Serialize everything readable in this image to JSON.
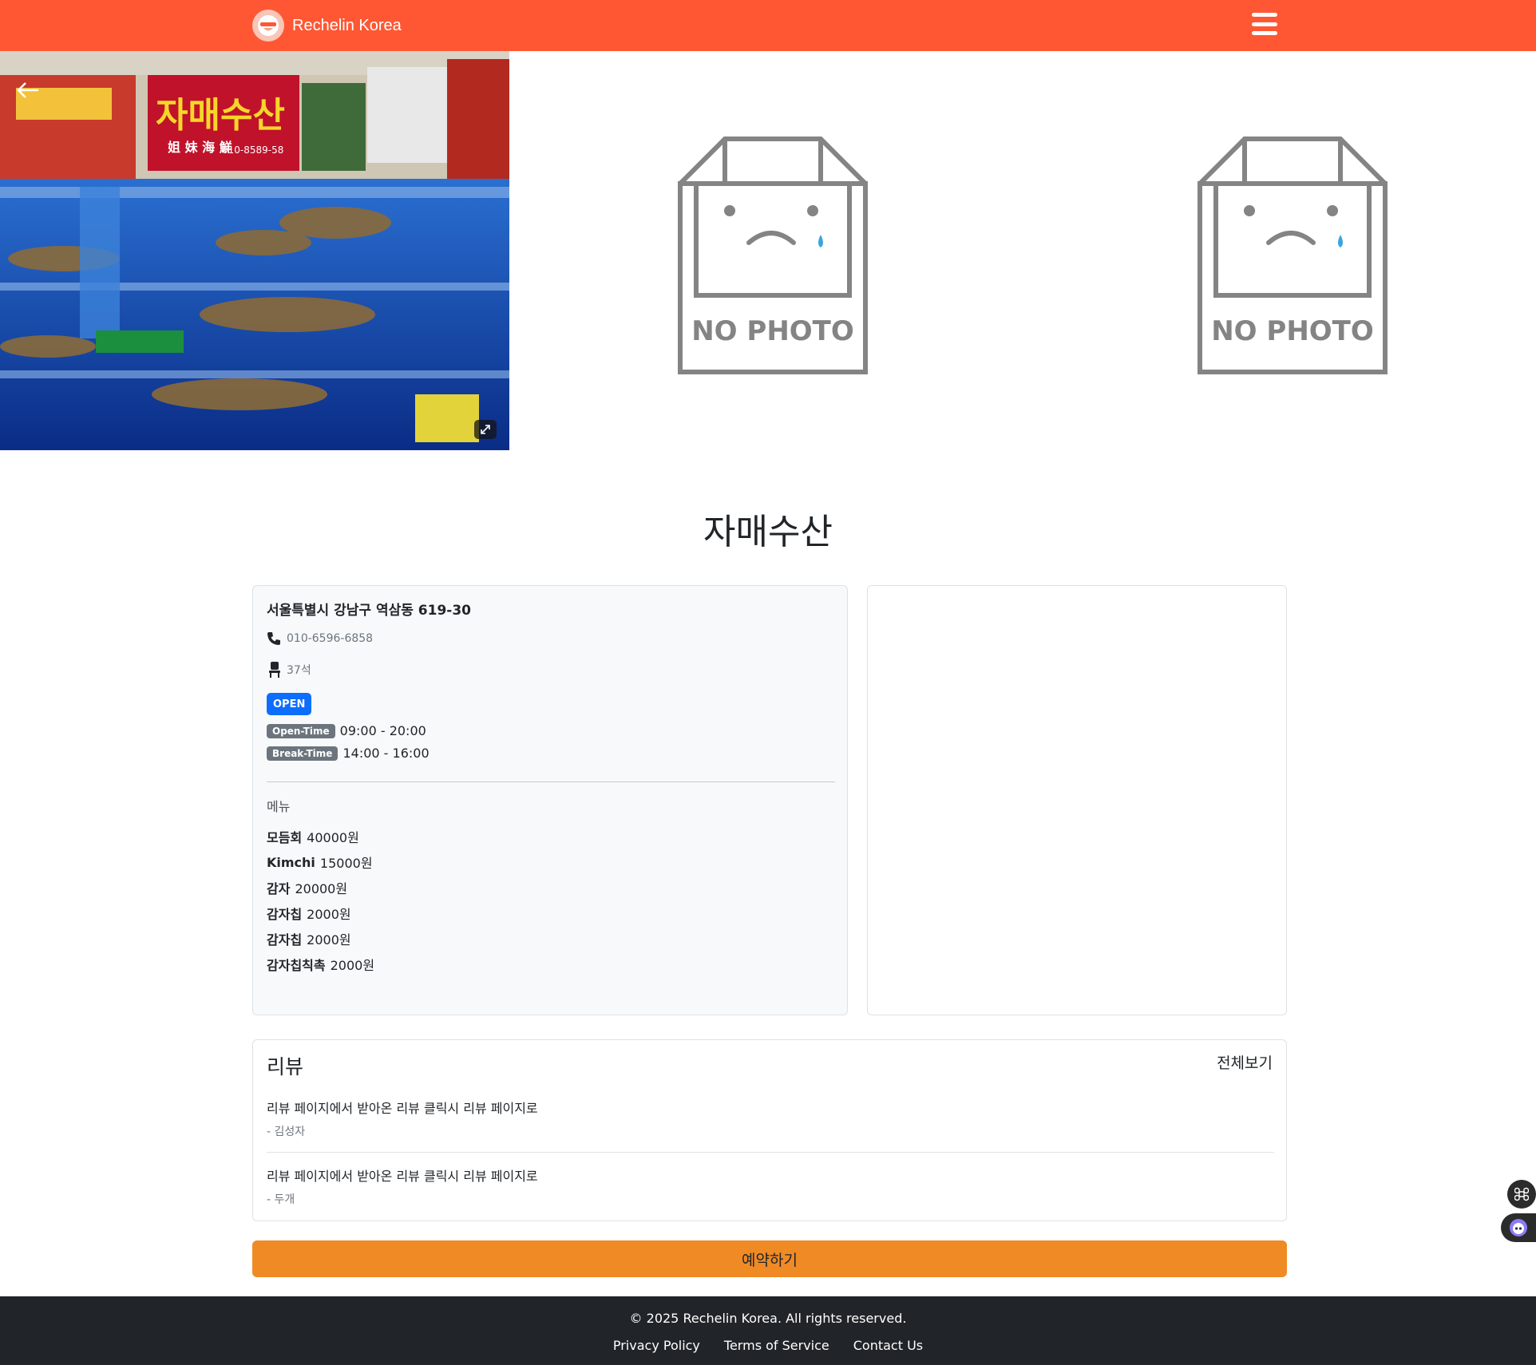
{
  "header": {
    "brand": "Rechelin Korea",
    "brand_color": "#ff5733"
  },
  "gallery": {
    "main_photo": {
      "sign_text": "자매수산",
      "sign_sub": "姐 妹 海 鮮",
      "sign_phone": "010-8589-58"
    },
    "placeholders": [
      {
        "label": "NO PHOTO"
      },
      {
        "label": "NO PHOTO"
      }
    ]
  },
  "store": {
    "name": "자매수산",
    "address": "서울특별시 강남구 역삼동 619-30",
    "phone": "010-6596-6858",
    "seats": "37석",
    "status": "OPEN",
    "open_time": {
      "label": "Open-Time",
      "value": "09:00 - 20:00"
    },
    "break_time": {
      "label": "Break-Time",
      "value": "14:00 - 16:00"
    },
    "menu_heading": "메뉴",
    "menu": [
      {
        "name": "모듬회",
        "price": "40000원"
      },
      {
        "name": "Kimchi",
        "price": "15000원"
      },
      {
        "name": "감자",
        "price": "20000원"
      },
      {
        "name": "감자칩",
        "price": "2000원"
      },
      {
        "name": "감자칩",
        "price": "2000원"
      },
      {
        "name": "감자칩칙촉",
        "price": "2000원"
      }
    ]
  },
  "reviews": {
    "title": "리뷰",
    "view_all": "전체보기",
    "items": [
      {
        "text": "리뷰 페이지에서 받아온 리뷰 클릭시 리뷰 페이지로",
        "author": "- 김성자"
      },
      {
        "text": "리뷰 페이지에서 받아온 리뷰 클릭시 리뷰 페이지로",
        "author": "- 두개"
      }
    ]
  },
  "actions": {
    "reserve_label": "예약하기",
    "reserve_color": "#f08a24"
  },
  "footer": {
    "copyright": "© 2025 Rechelin Korea. All rights reserved.",
    "links": [
      "Privacy Policy",
      "Terms of Service",
      "Contact Us"
    ]
  },
  "icons": {
    "back": "arrow-left-icon",
    "menu": "hamburger-icon",
    "phone": "phone-icon",
    "seat": "chair-icon",
    "expand": "expand-icon"
  }
}
